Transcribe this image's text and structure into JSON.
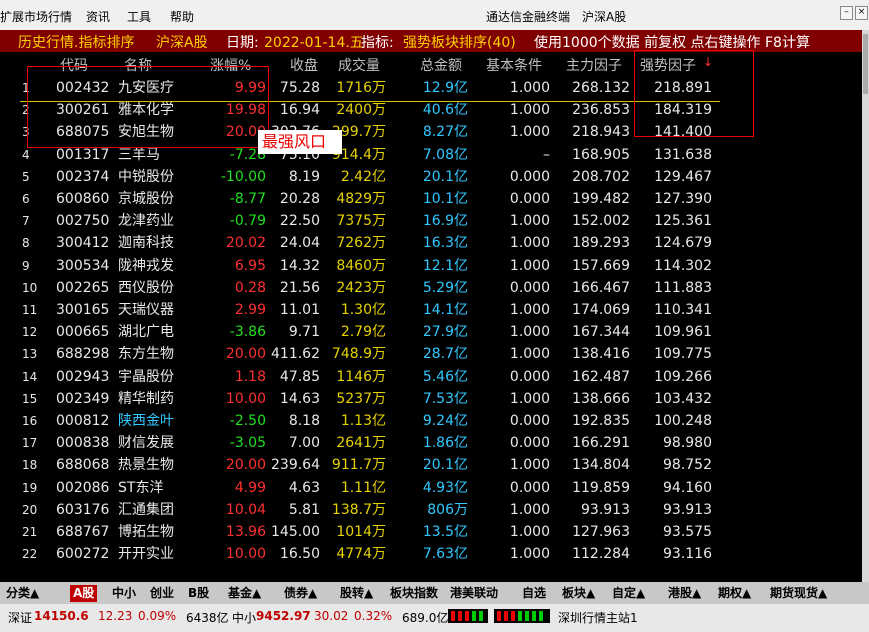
{
  "menu": {
    "items": [
      "扩展市场行情",
      "资讯",
      "工具",
      "帮助"
    ],
    "app_name": "通达信金融终端",
    "market": "沪深A股",
    "win_buttons": [
      "–",
      "×"
    ]
  },
  "titlebar": {
    "section": "历史行情.指标排序",
    "market": "沪深A股",
    "date_label": "日期:",
    "date": "2022-01-14.五",
    "indicator_label": "指标:",
    "indicator": "强势板块排序(40)",
    "info": "使用1000个数据 前复权 点右键操作 F8计算"
  },
  "columns": [
    "代码",
    "名称",
    "涨幅%",
    "收盘",
    "成交量",
    "总金额",
    "基本条件",
    "主力因子",
    "强势因子"
  ],
  "sort_arrow": "↓",
  "annotation": "最强风口",
  "rows": [
    {
      "no": "1",
      "code": "002432",
      "name": "九安医疗",
      "chg": "9.99",
      "close": "75.28",
      "vol": "1716万",
      "amt": "12.9亿",
      "base": "1.000",
      "main": "268.132",
      "strong": "218.891",
      "chg_color": "#ff3030",
      "name_color": "#e8e8e8"
    },
    {
      "no": "2",
      "code": "300261",
      "name": "雅本化学",
      "chg": "19.98",
      "close": "16.94",
      "vol": "2400万",
      "amt": "40.6亿",
      "base": "1.000",
      "main": "236.853",
      "strong": "184.319",
      "chg_color": "#ff3030",
      "name_color": "#e8e8e8"
    },
    {
      "no": "3",
      "code": "688075",
      "name": "安旭生物",
      "chg": "20.00",
      "close": "302.76",
      "vol": "299.7万",
      "amt": "8.27亿",
      "base": "1.000",
      "main": "218.943",
      "strong": "141.400",
      "chg_color": "#ff3030",
      "name_color": "#e8e8e8"
    },
    {
      "no": "4",
      "code": "001317",
      "name": "三羊马",
      "chg": "-7.28",
      "close": "75.10",
      "vol": "914.4万",
      "amt": "7.08亿",
      "base": "–",
      "main": "168.905",
      "strong": "131.638",
      "chg_color": "#20e020",
      "name_color": "#e8e8e8"
    },
    {
      "no": "5",
      "code": "002374",
      "name": "中锐股份",
      "chg": "-10.00",
      "close": "8.19",
      "vol": "2.42亿",
      "amt": "20.1亿",
      "base": "0.000",
      "main": "208.702",
      "strong": "129.467",
      "chg_color": "#20e020",
      "name_color": "#e8e8e8"
    },
    {
      "no": "6",
      "code": "600860",
      "name": "京城股份",
      "chg": "-8.77",
      "close": "20.28",
      "vol": "4829万",
      "amt": "10.1亿",
      "base": "0.000",
      "main": "199.482",
      "strong": "127.390",
      "chg_color": "#20e020",
      "name_color": "#e8e8e8"
    },
    {
      "no": "7",
      "code": "002750",
      "name": "龙津药业",
      "chg": "-0.79",
      "close": "22.50",
      "vol": "7375万",
      "amt": "16.9亿",
      "base": "1.000",
      "main": "152.002",
      "strong": "125.361",
      "chg_color": "#20e020",
      "name_color": "#e8e8e8"
    },
    {
      "no": "8",
      "code": "300412",
      "name": "迦南科技",
      "chg": "20.02",
      "close": "24.04",
      "vol": "7262万",
      "amt": "16.3亿",
      "base": "1.000",
      "main": "189.293",
      "strong": "124.679",
      "chg_color": "#ff3030",
      "name_color": "#e8e8e8"
    },
    {
      "no": "9",
      "code": "300534",
      "name": "陇神戎发",
      "chg": "6.95",
      "close": "14.32",
      "vol": "8460万",
      "amt": "12.1亿",
      "base": "1.000",
      "main": "157.669",
      "strong": "114.302",
      "chg_color": "#ff3030",
      "name_color": "#e8e8e8"
    },
    {
      "no": "10",
      "code": "002265",
      "name": "西仪股份",
      "chg": "0.28",
      "close": "21.56",
      "vol": "2423万",
      "amt": "5.29亿",
      "base": "0.000",
      "main": "166.467",
      "strong": "111.883",
      "chg_color": "#ff3030",
      "name_color": "#e8e8e8"
    },
    {
      "no": "11",
      "code": "300165",
      "name": "天瑞仪器",
      "chg": "2.99",
      "close": "11.01",
      "vol": "1.30亿",
      "amt": "14.1亿",
      "base": "1.000",
      "main": "174.069",
      "strong": "110.341",
      "chg_color": "#ff3030",
      "name_color": "#e8e8e8"
    },
    {
      "no": "12",
      "code": "000665",
      "name": "湖北广电",
      "chg": "-3.86",
      "close": "9.71",
      "vol": "2.79亿",
      "amt": "27.9亿",
      "base": "1.000",
      "main": "167.344",
      "strong": "109.961",
      "chg_color": "#20e020",
      "name_color": "#e8e8e8"
    },
    {
      "no": "13",
      "code": "688298",
      "name": "东方生物",
      "chg": "20.00",
      "close": "411.62",
      "vol": "748.9万",
      "amt": "28.7亿",
      "base": "1.000",
      "main": "138.416",
      "strong": "109.775",
      "chg_color": "#ff3030",
      "name_color": "#e8e8e8"
    },
    {
      "no": "14",
      "code": "002943",
      "name": "宇晶股份",
      "chg": "1.18",
      "close": "47.85",
      "vol": "1146万",
      "amt": "5.46亿",
      "base": "0.000",
      "main": "162.487",
      "strong": "109.266",
      "chg_color": "#ff3030",
      "name_color": "#e8e8e8"
    },
    {
      "no": "15",
      "code": "002349",
      "name": "精华制药",
      "chg": "10.00",
      "close": "14.63",
      "vol": "5237万",
      "amt": "7.53亿",
      "base": "1.000",
      "main": "138.666",
      "strong": "103.432",
      "chg_color": "#ff3030",
      "name_color": "#e8e8e8"
    },
    {
      "no": "16",
      "code": "000812",
      "name": "陕西金叶",
      "chg": "-2.50",
      "close": "8.18",
      "vol": "1.13亿",
      "amt": "9.24亿",
      "base": "0.000",
      "main": "192.835",
      "strong": "100.248",
      "chg_color": "#20e020",
      "name_color": "#30c8ff"
    },
    {
      "no": "17",
      "code": "000838",
      "name": "财信发展",
      "chg": "-3.05",
      "close": "7.00",
      "vol": "2641万",
      "amt": "1.86亿",
      "base": "0.000",
      "main": "166.291",
      "strong": "98.980",
      "chg_color": "#20e020",
      "name_color": "#e8e8e8"
    },
    {
      "no": "18",
      "code": "688068",
      "name": "热景生物",
      "chg": "20.00",
      "close": "239.64",
      "vol": "911.7万",
      "amt": "20.1亿",
      "base": "1.000",
      "main": "134.804",
      "strong": "98.752",
      "chg_color": "#ff3030",
      "name_color": "#e8e8e8"
    },
    {
      "no": "19",
      "code": "002086",
      "name": "ST东洋",
      "chg": "4.99",
      "close": "4.63",
      "vol": "1.11亿",
      "amt": "4.93亿",
      "base": "0.000",
      "main": "119.859",
      "strong": "94.160",
      "chg_color": "#ff3030",
      "name_color": "#e8e8e8"
    },
    {
      "no": "20",
      "code": "603176",
      "name": "汇通集团",
      "chg": "10.04",
      "close": "5.81",
      "vol": "138.7万",
      "amt": "806万",
      "base": "1.000",
      "main": "93.913",
      "strong": "93.913",
      "chg_color": "#ff3030",
      "name_color": "#e8e8e8"
    },
    {
      "no": "21",
      "code": "688767",
      "name": "博拓生物",
      "chg": "13.96",
      "close": "145.00",
      "vol": "1014万",
      "amt": "13.5亿",
      "base": "1.000",
      "main": "127.963",
      "strong": "93.575",
      "chg_color": "#ff3030",
      "name_color": "#e8e8e8"
    },
    {
      "no": "22",
      "code": "600272",
      "name": "开开实业",
      "chg": "10.00",
      "close": "16.50",
      "vol": "4774万",
      "amt": "7.63亿",
      "base": "1.000",
      "main": "112.284",
      "strong": "93.116",
      "chg_color": "#ff3030",
      "name_color": "#e8e8e8"
    }
  ],
  "tabs": [
    {
      "label": "分类▲",
      "active": false
    },
    {
      "label": "A股",
      "active": true
    },
    {
      "label": "中小",
      "active": false
    },
    {
      "label": "创业",
      "active": false
    },
    {
      "label": "B股",
      "active": false
    },
    {
      "label": "基金▲",
      "active": false
    },
    {
      "label": "债券▲",
      "active": false
    },
    {
      "label": "股转▲",
      "active": false
    },
    {
      "label": "板块指数",
      "active": false
    },
    {
      "label": "港美联动",
      "active": false
    },
    {
      "label": "自选",
      "active": false
    },
    {
      "label": "板块▲",
      "active": false
    },
    {
      "label": "自定▲",
      "active": false
    },
    {
      "label": "港股▲",
      "active": false
    },
    {
      "label": "期权▲",
      "active": false
    },
    {
      "label": "期货现货▲",
      "active": false
    }
  ],
  "status": {
    "sz_label": "深证",
    "sz_value": "14150.6",
    "sz_chg": "12.23",
    "sz_pct": "0.09%",
    "sz_amt": "6438亿",
    "zx_label": "中小",
    "zx_value": "9452.97",
    "zx_chg": "30.02",
    "zx_pct": "0.32%",
    "zx_amt": "689.0亿",
    "station": "深圳行情主站1"
  },
  "colors": {
    "up": "#ff3030",
    "down": "#20e020",
    "volume": "#e6d200",
    "amount": "#30c8ff",
    "header": "#c0c0c0",
    "title_bg": "#800000",
    "title_text": "#ffd000",
    "annotation": "#e00000"
  }
}
